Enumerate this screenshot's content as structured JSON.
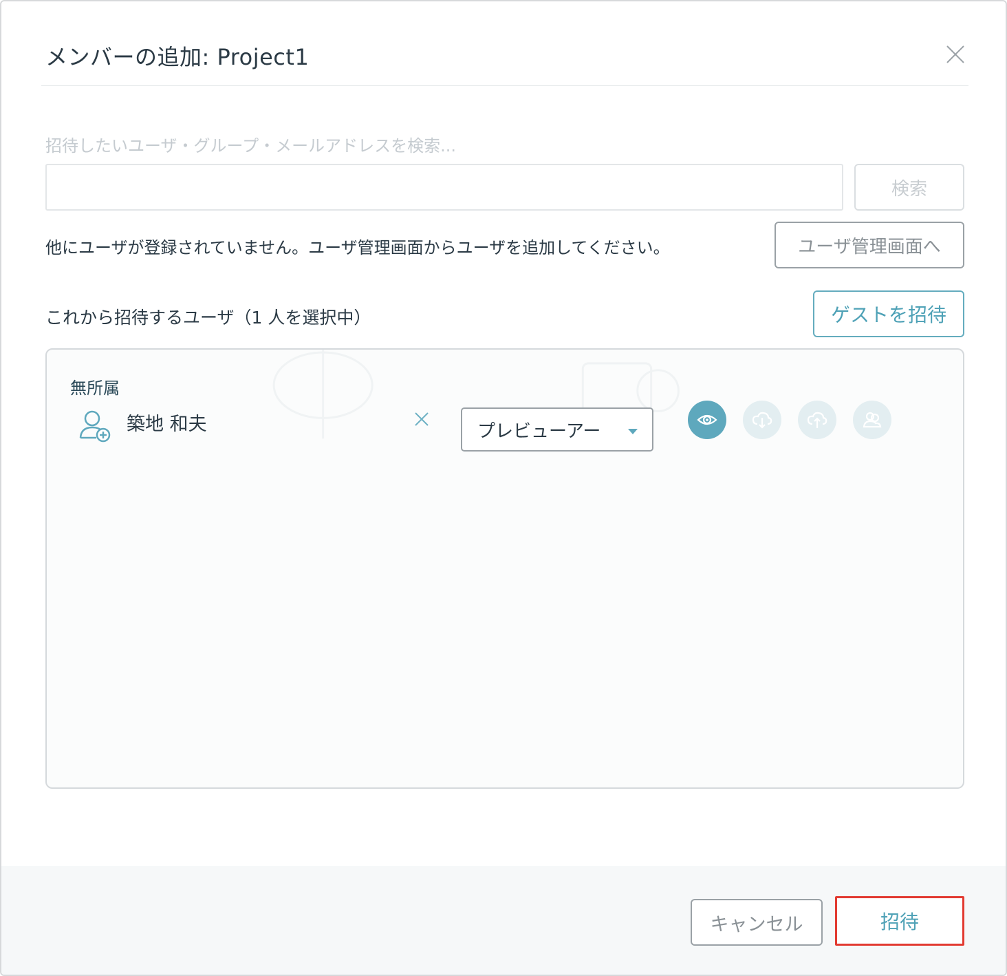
{
  "dialog": {
    "title": "メンバーの追加: Project1"
  },
  "search": {
    "hint": "招待したいユーザ・グループ・メールアドレスを検索...",
    "value": "",
    "button_label": "検索"
  },
  "notice": {
    "text": "他にユーザが登録されていません。ユーザ管理画面からユーザを追加してください。",
    "button_label": "ユーザ管理画面へ"
  },
  "selection": {
    "label": "これから招待するユーザ（1 人を選択中）",
    "guest_button_label": "ゲストを招待"
  },
  "panel": {
    "group_label": "無所属",
    "user": {
      "name": "築地 和夫",
      "role": "プレビューアー",
      "permissions": [
        {
          "icon": "eye-icon",
          "active": true
        },
        {
          "icon": "cloud-download-icon",
          "active": false
        },
        {
          "icon": "cloud-upload-icon",
          "active": false
        },
        {
          "icon": "users-icon",
          "active": false
        }
      ]
    }
  },
  "footer": {
    "cancel_label": "キャンセル",
    "invite_label": "招待"
  },
  "colors": {
    "accent": "#5ea8bd",
    "highlight": "#e23a31"
  }
}
